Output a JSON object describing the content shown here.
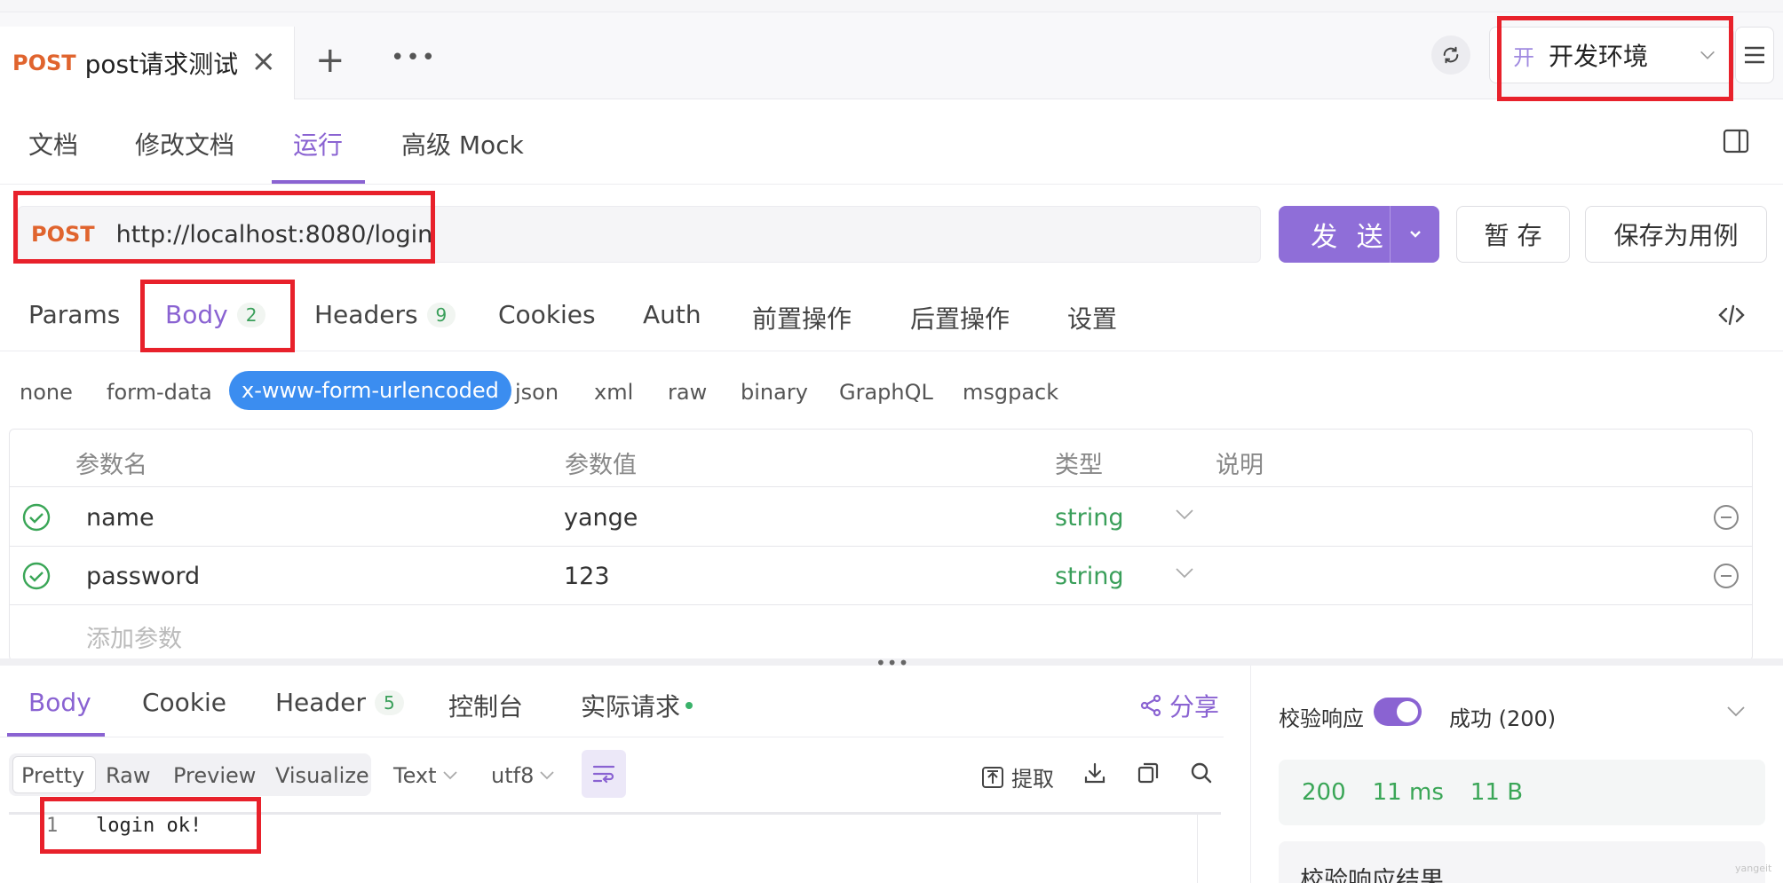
{
  "tab": {
    "method": "POST",
    "title": "post请求测试"
  },
  "env": {
    "badge": "开",
    "label": "开发环境"
  },
  "subtabs": [
    "文档",
    "修改文档",
    "运行",
    "高级 Mock"
  ],
  "request": {
    "method": "POST",
    "url": "http://localhost:8080/login"
  },
  "actions": {
    "send": "发 送",
    "save": "暂 存",
    "save_case": "保存为用例"
  },
  "req_tabs": {
    "params": "Params",
    "body": "Body",
    "body_count": "2",
    "headers": "Headers",
    "headers_count": "9",
    "cookies": "Cookies",
    "auth": "Auth",
    "pre": "前置操作",
    "post": "后置操作",
    "settings": "设置"
  },
  "body_types": [
    "none",
    "form-data",
    "x-www-form-urlencoded",
    "json",
    "xml",
    "raw",
    "binary",
    "GraphQL",
    "msgpack"
  ],
  "params_table": {
    "headers": [
      "参数名",
      "参数值",
      "类型",
      "说明"
    ],
    "rows": [
      {
        "name": "name",
        "value": "yange",
        "type": "string"
      },
      {
        "name": "password",
        "value": "123",
        "type": "string"
      }
    ],
    "add_placeholder": "添加参数"
  },
  "resp_tabs": {
    "body": "Body",
    "cookie": "Cookie",
    "header": "Header",
    "header_count": "5",
    "console": "控制台",
    "actual": "实际请求",
    "share": "分享"
  },
  "view_modes": [
    "Pretty",
    "Raw",
    "Preview",
    "Visualize"
  ],
  "format": {
    "type": "Text",
    "encoding": "utf8"
  },
  "tools": {
    "extract": "提取"
  },
  "response_code": {
    "line": "1",
    "text": "login ok!"
  },
  "verify": {
    "label": "校验响应",
    "status": "成功 (200)",
    "enabled": true
  },
  "stats": {
    "code": "200",
    "time": "11 ms",
    "size": "11 B"
  },
  "verify_result": "校验响应结果",
  "watermark": "yangeit",
  "colors": {
    "accent": "#8a63d2",
    "post": "#e0642e",
    "success": "#3aa657",
    "highlight": "#e8212b",
    "pill": "#3b8df0"
  }
}
